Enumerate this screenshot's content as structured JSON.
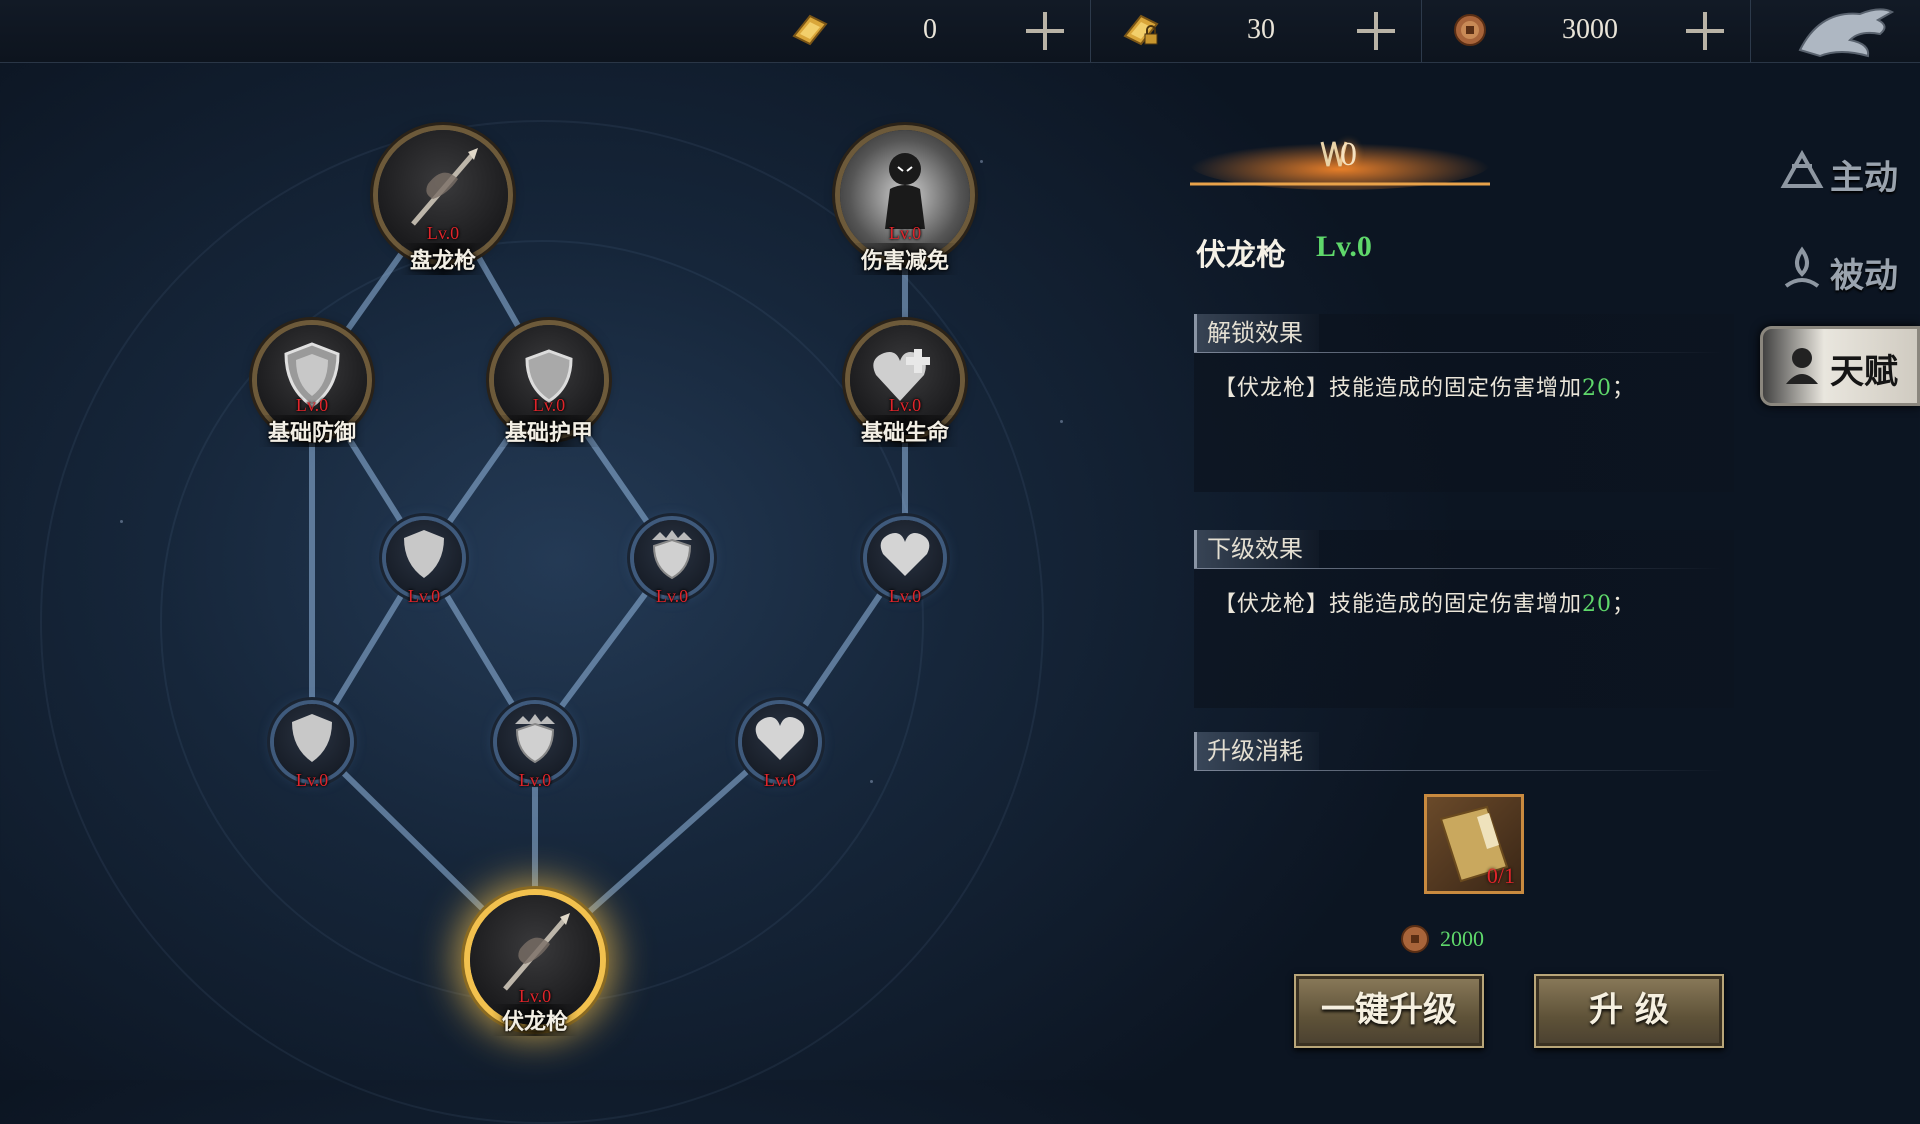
{
  "currencies": [
    {
      "icon": "gold-ingot-icon",
      "value": "0"
    },
    {
      "icon": "locked-gold-ingot-icon",
      "value": "30"
    },
    {
      "icon": "copper-coin-icon",
      "value": "3000"
    }
  ],
  "tabs": [
    {
      "label": "主动",
      "icon": "active-skill-icon",
      "active": false
    },
    {
      "label": "被动",
      "icon": "passive-skill-icon",
      "active": false
    },
    {
      "label": "天赋",
      "icon": "talent-icon",
      "active": true
    }
  ],
  "tree": {
    "nodes": [
      {
        "id": "panlong",
        "label": "盘龙枪",
        "level": "Lv.0",
        "kind": "spear-skill-icon"
      },
      {
        "id": "shanghai",
        "label": "伤害减免",
        "level": "Lv.0",
        "kind": "damage-reduction-icon"
      },
      {
        "id": "fangyu",
        "label": "基础防御",
        "level": "Lv.0",
        "kind": "shield-icon"
      },
      {
        "id": "hujia",
        "label": "基础护甲",
        "level": "Lv.0",
        "kind": "armor-shield-icon"
      },
      {
        "id": "shengming",
        "label": "基础生命",
        "level": "Lv.0",
        "kind": "heart-plus-icon"
      },
      {
        "id": "m1",
        "label": "",
        "level": "Lv.0",
        "kind": "shield-icon"
      },
      {
        "id": "m2",
        "label": "",
        "level": "Lv.0",
        "kind": "crowned-shield-icon"
      },
      {
        "id": "m3",
        "label": "",
        "level": "Lv.0",
        "kind": "heart-icon"
      },
      {
        "id": "l1",
        "label": "",
        "level": "Lv.0",
        "kind": "shield-icon"
      },
      {
        "id": "l2",
        "label": "",
        "level": "Lv.0",
        "kind": "crowned-shield-icon"
      },
      {
        "id": "l3",
        "label": "",
        "level": "Lv.0",
        "kind": "heart-icon"
      },
      {
        "id": "fulong",
        "label": "伏龙枪",
        "level": "Lv.0",
        "kind": "spear-skill-icon",
        "selected": true
      }
    ]
  },
  "detail": {
    "rank_value": "0",
    "skill_name": "伏龙枪",
    "skill_level": "Lv.0",
    "unlock_title": "解锁效果",
    "unlock_text_pre": "【伏龙枪】技能造成的固定伤害增加",
    "unlock_text_num": "20",
    "unlock_text_post": "；",
    "next_title": "下级效果",
    "next_text_pre": "【伏龙枪】技能造成的固定伤害增加",
    "next_text_num": "20",
    "next_text_post": "；",
    "cost_title": "升级消耗",
    "cost_item_count": "0/1",
    "coin_cost": "2000",
    "btn_one_click": "一键升级",
    "btn_upgrade": "升 级"
  },
  "colors": {
    "accent_green": "#5fd86b",
    "level_red": "#e0242a",
    "gold": "#f2c14e"
  }
}
